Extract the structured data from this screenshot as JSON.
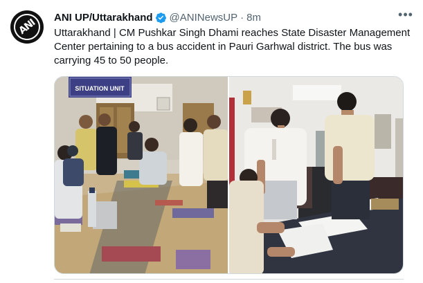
{
  "tweet": {
    "author_name": "ANI UP/Uttarakhand",
    "handle": "@ANINewsUP",
    "separator": "·",
    "time": "8m",
    "more_label": "•••",
    "text": "Uttarakhand | CM Pushkar Singh Dhami reaches State Disaster Management Center pertaining to a bus accident in Pauri Garhwal district. The bus was carrying 45 to 50 people.",
    "avatar_text": "ANI",
    "verified_icon": "verified-badge-icon",
    "verified_color": "#1d9bf0"
  },
  "media": {
    "photo_left_sign": "SITUATION UNIT"
  }
}
